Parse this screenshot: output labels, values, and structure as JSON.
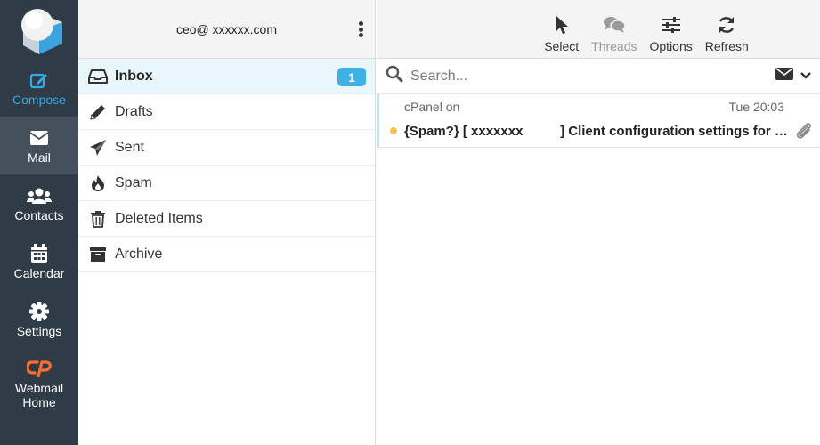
{
  "nav": {
    "compose": "Compose",
    "mail": "Mail",
    "contacts": "Contacts",
    "calendar": "Calendar",
    "settings": "Settings",
    "webmail": "Webmail Home"
  },
  "account": {
    "email": "ceo@ xxxxxx.com"
  },
  "folders": [
    {
      "label": "Inbox",
      "icon": "inbox-icon",
      "badge": "1"
    },
    {
      "label": "Drafts",
      "icon": "pencil-icon"
    },
    {
      "label": "Sent",
      "icon": "paper-plane-icon"
    },
    {
      "label": "Spam",
      "icon": "fire-icon"
    },
    {
      "label": "Deleted Items",
      "icon": "trash-icon"
    },
    {
      "label": "Archive",
      "icon": "archive-box-icon"
    }
  ],
  "toolbar": {
    "select": "Select",
    "threads": "Threads",
    "options": "Options",
    "refresh": "Refresh"
  },
  "search": {
    "placeholder": "Search..."
  },
  "messages": [
    {
      "from": "cPanel on",
      "date": "Tue 20:03",
      "subject": "{Spam?} [ xxxxxxx          ] Client configuration settings for “ceo@xxxxxx.com”."
    }
  ],
  "colors": {
    "accent": "#3fb1e6",
    "nav_bg": "#2f3b46",
    "unread_dot": "#f3c44b",
    "cpanel_orange": "#ff6c2c"
  }
}
